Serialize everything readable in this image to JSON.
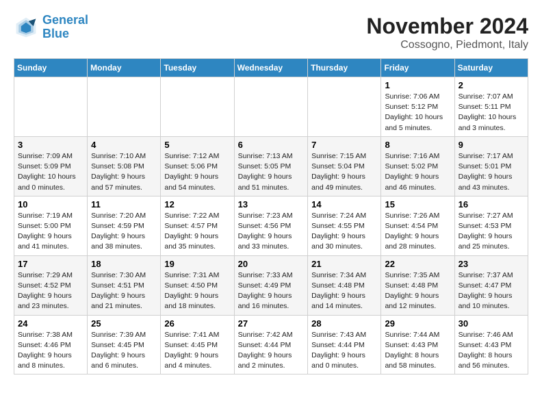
{
  "logo": {
    "line1": "General",
    "line2": "Blue"
  },
  "title": "November 2024",
  "location": "Cossogno, Piedmont, Italy",
  "days_of_week": [
    "Sunday",
    "Monday",
    "Tuesday",
    "Wednesday",
    "Thursday",
    "Friday",
    "Saturday"
  ],
  "weeks": [
    [
      {
        "day": "",
        "info": ""
      },
      {
        "day": "",
        "info": ""
      },
      {
        "day": "",
        "info": ""
      },
      {
        "day": "",
        "info": ""
      },
      {
        "day": "",
        "info": ""
      },
      {
        "day": "1",
        "info": "Sunrise: 7:06 AM\nSunset: 5:12 PM\nDaylight: 10 hours\nand 5 minutes."
      },
      {
        "day": "2",
        "info": "Sunrise: 7:07 AM\nSunset: 5:11 PM\nDaylight: 10 hours\nand 3 minutes."
      }
    ],
    [
      {
        "day": "3",
        "info": "Sunrise: 7:09 AM\nSunset: 5:09 PM\nDaylight: 10 hours\nand 0 minutes."
      },
      {
        "day": "4",
        "info": "Sunrise: 7:10 AM\nSunset: 5:08 PM\nDaylight: 9 hours\nand 57 minutes."
      },
      {
        "day": "5",
        "info": "Sunrise: 7:12 AM\nSunset: 5:06 PM\nDaylight: 9 hours\nand 54 minutes."
      },
      {
        "day": "6",
        "info": "Sunrise: 7:13 AM\nSunset: 5:05 PM\nDaylight: 9 hours\nand 51 minutes."
      },
      {
        "day": "7",
        "info": "Sunrise: 7:15 AM\nSunset: 5:04 PM\nDaylight: 9 hours\nand 49 minutes."
      },
      {
        "day": "8",
        "info": "Sunrise: 7:16 AM\nSunset: 5:02 PM\nDaylight: 9 hours\nand 46 minutes."
      },
      {
        "day": "9",
        "info": "Sunrise: 7:17 AM\nSunset: 5:01 PM\nDaylight: 9 hours\nand 43 minutes."
      }
    ],
    [
      {
        "day": "10",
        "info": "Sunrise: 7:19 AM\nSunset: 5:00 PM\nDaylight: 9 hours\nand 41 minutes."
      },
      {
        "day": "11",
        "info": "Sunrise: 7:20 AM\nSunset: 4:59 PM\nDaylight: 9 hours\nand 38 minutes."
      },
      {
        "day": "12",
        "info": "Sunrise: 7:22 AM\nSunset: 4:57 PM\nDaylight: 9 hours\nand 35 minutes."
      },
      {
        "day": "13",
        "info": "Sunrise: 7:23 AM\nSunset: 4:56 PM\nDaylight: 9 hours\nand 33 minutes."
      },
      {
        "day": "14",
        "info": "Sunrise: 7:24 AM\nSunset: 4:55 PM\nDaylight: 9 hours\nand 30 minutes."
      },
      {
        "day": "15",
        "info": "Sunrise: 7:26 AM\nSunset: 4:54 PM\nDaylight: 9 hours\nand 28 minutes."
      },
      {
        "day": "16",
        "info": "Sunrise: 7:27 AM\nSunset: 4:53 PM\nDaylight: 9 hours\nand 25 minutes."
      }
    ],
    [
      {
        "day": "17",
        "info": "Sunrise: 7:29 AM\nSunset: 4:52 PM\nDaylight: 9 hours\nand 23 minutes."
      },
      {
        "day": "18",
        "info": "Sunrise: 7:30 AM\nSunset: 4:51 PM\nDaylight: 9 hours\nand 21 minutes."
      },
      {
        "day": "19",
        "info": "Sunrise: 7:31 AM\nSunset: 4:50 PM\nDaylight: 9 hours\nand 18 minutes."
      },
      {
        "day": "20",
        "info": "Sunrise: 7:33 AM\nSunset: 4:49 PM\nDaylight: 9 hours\nand 16 minutes."
      },
      {
        "day": "21",
        "info": "Sunrise: 7:34 AM\nSunset: 4:48 PM\nDaylight: 9 hours\nand 14 minutes."
      },
      {
        "day": "22",
        "info": "Sunrise: 7:35 AM\nSunset: 4:48 PM\nDaylight: 9 hours\nand 12 minutes."
      },
      {
        "day": "23",
        "info": "Sunrise: 7:37 AM\nSunset: 4:47 PM\nDaylight: 9 hours\nand 10 minutes."
      }
    ],
    [
      {
        "day": "24",
        "info": "Sunrise: 7:38 AM\nSunset: 4:46 PM\nDaylight: 9 hours\nand 8 minutes."
      },
      {
        "day": "25",
        "info": "Sunrise: 7:39 AM\nSunset: 4:45 PM\nDaylight: 9 hours\nand 6 minutes."
      },
      {
        "day": "26",
        "info": "Sunrise: 7:41 AM\nSunset: 4:45 PM\nDaylight: 9 hours\nand 4 minutes."
      },
      {
        "day": "27",
        "info": "Sunrise: 7:42 AM\nSunset: 4:44 PM\nDaylight: 9 hours\nand 2 minutes."
      },
      {
        "day": "28",
        "info": "Sunrise: 7:43 AM\nSunset: 4:44 PM\nDaylight: 9 hours\nand 0 minutes."
      },
      {
        "day": "29",
        "info": "Sunrise: 7:44 AM\nSunset: 4:43 PM\nDaylight: 8 hours\nand 58 minutes."
      },
      {
        "day": "30",
        "info": "Sunrise: 7:46 AM\nSunset: 4:43 PM\nDaylight: 8 hours\nand 56 minutes."
      }
    ]
  ]
}
